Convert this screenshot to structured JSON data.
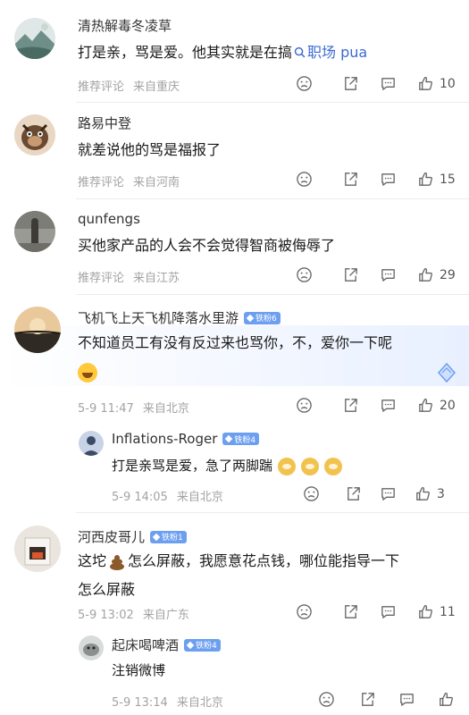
{
  "icons": {
    "sad": "sad-face-icon",
    "share": "share-icon",
    "reply": "comment-icon",
    "like": "thumbs-up-icon"
  },
  "colors": {
    "accent": "#3d6ad1",
    "meta": "#a3a3a3",
    "badge": "#6d9ff0"
  },
  "comments": [
    {
      "user": "清热解毒冬凌草",
      "text_pre": "打是亲，骂是爱。他其实就是在搞",
      "search_link": "职场 pua",
      "tag": "推荐评论",
      "location": "来自重庆",
      "likes": "10"
    },
    {
      "user": "路易中登",
      "text": "就差说他的骂是福报了",
      "tag": "推荐评论",
      "location": "来自河南",
      "likes": "15"
    },
    {
      "user": "qunfengs",
      "text": "买他家产品的人会不会觉得智商被侮辱了",
      "tag": "推荐评论",
      "location": "来自江苏",
      "likes": "29"
    },
    {
      "user": "飞机飞上天飞机降落水里游",
      "badge": "铁粉6",
      "text": "不知道员工有没有反过来也骂你，不，爱你一下呢",
      "date": "5-9 11:47",
      "location": "来自北京",
      "likes": "20"
    },
    {
      "user": "Inflations-Roger",
      "badge": "铁粉4",
      "text": "打是亲骂是爱，急了两脚踹",
      "date": "5-9 14:05",
      "location": "来自北京",
      "likes": "3"
    },
    {
      "user": "河西皮哥儿",
      "badge": "铁粉1",
      "text_a": "这坨",
      "text_b": "怎么屏蔽，我愿意花点钱，哪位能指导一下",
      "text_c": "怎么屏蔽",
      "date": "5-9 13:02",
      "location": "来自广东",
      "likes": "11"
    },
    {
      "user": "起床喝啤酒",
      "badge": "铁粉4",
      "text": "注销微博",
      "date": "5-9 13:14",
      "location": "来自北京",
      "likes": ""
    }
  ]
}
